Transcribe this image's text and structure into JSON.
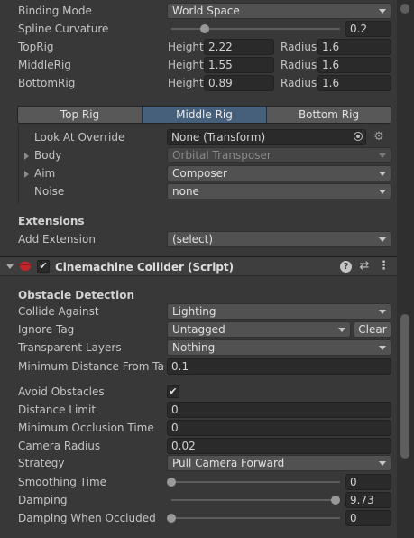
{
  "camera": {
    "binding_mode": {
      "label": "Binding Mode",
      "value": "World Space"
    },
    "spline_curvature": {
      "label": "Spline Curvature",
      "value": "0.2",
      "level": 0.2
    },
    "rigs": [
      {
        "label": "TopRig",
        "height_label": "Height",
        "height": "2.22",
        "radius_label": "Radius",
        "radius": "1.6"
      },
      {
        "label": "MiddleRig",
        "height_label": "Height",
        "height": "1.55",
        "radius_label": "Radius",
        "radius": "1.6"
      },
      {
        "label": "BottomRig",
        "height_label": "Height",
        "height": "0.89",
        "radius_label": "Radius",
        "radius": "1.6"
      }
    ],
    "rig_tabs": [
      {
        "label": "Top Rig",
        "active": false
      },
      {
        "label": "Middle Rig",
        "active": true
      },
      {
        "label": "Bottom Rig",
        "active": false
      }
    ],
    "look_at_override": {
      "label": "Look At Override",
      "value": "None (Transform)"
    },
    "body": {
      "label": "Body",
      "value": "Orbital Transposer"
    },
    "aim": {
      "label": "Aim",
      "value": "Composer"
    },
    "noise": {
      "label": "Noise",
      "value": "none"
    },
    "extensions": {
      "title": "Extensions",
      "add_label": "Add Extension",
      "add_value": "(select)"
    }
  },
  "collider": {
    "title": "Cinemachine Collider (Script)",
    "enabled": true,
    "obstacle_detection": "Obstacle Detection",
    "collide_against": {
      "label": "Collide Against",
      "value": "Lighting"
    },
    "ignore_tag": {
      "label": "Ignore Tag",
      "value": "Untagged",
      "clear": "Clear"
    },
    "transparent_layers": {
      "label": "Transparent Layers",
      "value": "Nothing"
    },
    "minimum_distance": {
      "label": "Minimum Distance From Targ",
      "value": "0.1"
    },
    "avoid_obstacles": {
      "label": "Avoid Obstacles",
      "checked": true
    },
    "distance_limit": {
      "label": "Distance Limit",
      "value": "0"
    },
    "min_occlusion_time": {
      "label": "Minimum Occlusion Time",
      "value": "0"
    },
    "camera_radius": {
      "label": "Camera Radius",
      "value": "0.02"
    },
    "strategy": {
      "label": "Strategy",
      "value": "Pull Camera Forward"
    },
    "smoothing_time": {
      "label": "Smoothing Time",
      "value": "0",
      "level": 0.0
    },
    "damping": {
      "label": "Damping",
      "value": "9.73",
      "level": 0.973
    },
    "damping_occluded": {
      "label": "Damping When Occluded",
      "value": "0",
      "level": 0.0
    }
  },
  "icons": [
    "settings-gear-icon",
    "target-picker-icon",
    "help-icon",
    "presets-icon",
    "kebab-menu-icon",
    "script-bug-icon",
    "foldout-arrow-icon"
  ],
  "colors": {
    "background": "#383838",
    "field": "#2a2a2a",
    "active_tab": "#46607c"
  }
}
